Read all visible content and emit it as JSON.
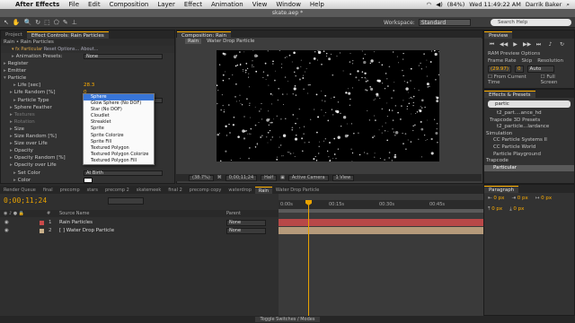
{
  "menubar": {
    "apple": "",
    "items": [
      "After Effects",
      "File",
      "Edit",
      "Composition",
      "Layer",
      "Effect",
      "Animation",
      "View",
      "Window",
      "Help"
    ],
    "clock": "Wed 11:49:22 AM",
    "user": "Darrik Baker",
    "battery": "(84%)"
  },
  "window": {
    "title": "skate.aep *"
  },
  "toolbar": {
    "workspace_label": "Workspace:",
    "workspace_value": "Standard",
    "search_placeholder": "Search Help"
  },
  "left_panel": {
    "tabs": [
      "Project",
      "Effect Controls: Rain Particles"
    ],
    "header": "Rain • Rain Particles",
    "rows": [
      {
        "label": "Animation Presets:",
        "value": "None",
        "kind": "dd",
        "indent": 12
      },
      {
        "label": "Register",
        "kind": "group",
        "indent": 3
      },
      {
        "label": "Emitter",
        "kind": "group",
        "indent": 3
      },
      {
        "label": "Particle",
        "kind": "group-open",
        "indent": 3
      },
      {
        "label": "Life [sec]",
        "value": "28.3",
        "kind": "val",
        "indent": 14
      },
      {
        "label": "Life Random [%]",
        "value": "0",
        "kind": "val",
        "indent": 10
      },
      {
        "label": "Particle Type",
        "value": "Sphere",
        "kind": "dd",
        "indent": 14
      },
      {
        "label": "Sphere Feather",
        "kind": "group",
        "indent": 10
      },
      {
        "label": "Textures",
        "kind": "group-dim",
        "indent": 10
      },
      {
        "label": "Rotation",
        "kind": "group-dim",
        "indent": 10
      },
      {
        "label": "Size",
        "value": "",
        "kind": "val",
        "indent": 10
      },
      {
        "label": "Size Random [%]",
        "kind": "val",
        "indent": 10
      },
      {
        "label": "Size over Life",
        "kind": "group",
        "indent": 10
      },
      {
        "label": "Opacity",
        "kind": "val",
        "indent": 10
      },
      {
        "label": "Opacity Random [%]",
        "kind": "val",
        "indent": 10
      },
      {
        "label": "Opacity over Life",
        "kind": "group",
        "indent": 10
      },
      {
        "label": "Set Color",
        "value": "At Birth",
        "kind": "dd",
        "indent": 14
      },
      {
        "label": "Color",
        "kind": "color",
        "indent": 14
      }
    ],
    "particle_type_options": [
      "Sphere",
      "Glow Sphere (No DOF)",
      "Star (No DOF)",
      "Cloudlet",
      "Streaklet",
      "Sprite",
      "Sprite Colorize",
      "Sprite Fill",
      "Textured Polygon",
      "Textured Polygon Colorize",
      "Textured Polygon Fill"
    ],
    "selected_option": "Sphere"
  },
  "comp_panel": {
    "tab_label": "Rain",
    "breadcrumb": [
      "Rain",
      "Water Drop Particle"
    ],
    "footer": {
      "zoom": "(38.7%)",
      "timecode": "0;00;11;24",
      "resolution": "Half",
      "camera": "Active Camera",
      "view": "1 View"
    }
  },
  "preview_panel": {
    "title": "Preview",
    "ram_label": "RAM Preview Options",
    "frame_rate_label": "Frame Rate",
    "frame_rate": "(29.97)",
    "skip_label": "Skip",
    "skip": "0",
    "resolution_label": "Resolution",
    "resolution": "Auto",
    "from_current": "From Current Time",
    "full_screen": "Full Screen"
  },
  "effects_panel": {
    "title": "Effects & Presets",
    "search_value": "partic",
    "items": [
      {
        "label": "t2_part....ance_hd",
        "indent": 14
      },
      {
        "label": "Trapcode 3D Presets",
        "indent": 6
      },
      {
        "label": "t2_particle...lardance",
        "indent": 14
      },
      {
        "label": "Simulation",
        "indent": 2
      },
      {
        "label": "CC Particle Systems II",
        "indent": 10
      },
      {
        "label": "CC Particle World",
        "indent": 10
      },
      {
        "label": "Particle Playground",
        "indent": 10
      },
      {
        "label": "Trapcode",
        "indent": 2
      },
      {
        "label": "Particular",
        "indent": 10,
        "highlight": true
      }
    ]
  },
  "timeline": {
    "tabs": [
      "Render Queue",
      "final",
      "precomp",
      "stars",
      "precomp 2",
      "skatemeek",
      "final 2",
      "precomp copy",
      "waterdrop",
      "Rain",
      "Water Drop Particle"
    ],
    "active_tab": "Rain",
    "timecode": "0;00;11;24",
    "col_source": "Source Name",
    "col_parent": "Parent",
    "layers": [
      {
        "num": "1",
        "name": "Rain Particles",
        "parent": "None",
        "color": "#c94a4a"
      },
      {
        "num": "2",
        "name": "[ ] Water Drop Particle",
        "parent": "None",
        "color": "#c9b08a"
      }
    ],
    "ruler": [
      "0:00s",
      "00:15s",
      "00:30s",
      "00:45s"
    ],
    "toggle_label": "Toggle Switches / Modes"
  },
  "paragraph_panel": {
    "title": "Paragraph",
    "rows": [
      [
        "0 px",
        "0 px",
        "0 px"
      ],
      [
        "0 px",
        "0 px"
      ]
    ]
  }
}
